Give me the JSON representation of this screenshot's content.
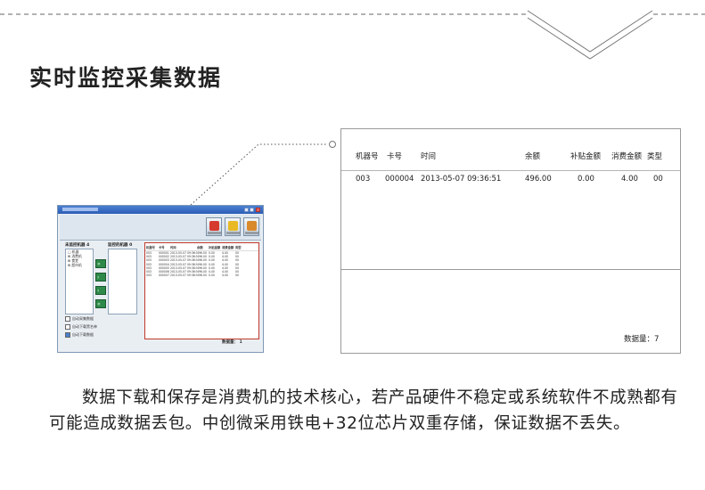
{
  "title": "实时监控采集数据",
  "mini_app": {
    "left_label": "未监控机器",
    "left_count": "4",
    "right_label": "监控的机器",
    "right_count": "0",
    "tree": [
      "□ 机器",
      "⊞ 消费机",
      "⊞ 食堂",
      "⊞ 超市机"
    ],
    "options": [
      "自动采集数据",
      "自动下载黑名单",
      "自动下载数据"
    ],
    "columns": [
      "机器号",
      "卡号",
      "时间",
      "余额",
      "补贴金额",
      "消费金额",
      "类型"
    ],
    "rows": [
      [
        "003",
        "000001",
        "2013-05-07 09:36:51",
        "496.00",
        "0.00",
        "4.00",
        "00"
      ],
      [
        "003",
        "000002",
        "2013-05-07 09:36:51",
        "496.00",
        "0.00",
        "4.00",
        "00"
      ],
      [
        "003",
        "000003",
        "2013-05-07 09:36:51",
        "496.00",
        "0.00",
        "4.00",
        "00"
      ],
      [
        "003",
        "000004",
        "2013-05-07 09:36:51",
        "496.00",
        "0.00",
        "4.00",
        "00"
      ],
      [
        "003",
        "000005",
        "2013-05-07 09:36:51",
        "496.00",
        "0.00",
        "4.00",
        "00"
      ],
      [
        "003",
        "000006",
        "2013-05-07 09:36:51",
        "496.00",
        "0.00",
        "4.00",
        "00"
      ],
      [
        "003",
        "000007",
        "2013-05-07 09:36:51",
        "496.00",
        "0.00",
        "4.00",
        "00"
      ]
    ],
    "count_label": "数据量：",
    "count_value": "1"
  },
  "zoom_table": {
    "columns": [
      "机器号",
      "卡号",
      "时间",
      "余额",
      "补贴金额",
      "消费金额",
      "类型"
    ],
    "row": [
      "003",
      "000004",
      "2013-05-07 09:36:51",
      "496.00",
      "0.00",
      "4.00",
      "00"
    ],
    "count_text": "数据量：7"
  },
  "paragraph": "数据下载和保存是消费机的技术核心，若产品硬件不稳定或系统软件不成熟都有可能造成数据丢包。中创微采用铁电+32位芯片双重存储，保证数据不丢失。",
  "colors": {
    "accent_red": "#c0392b",
    "button_green": "#2f8a4a",
    "titlebar_blue": "#2a5db5"
  },
  "icons": [
    "collect-icon",
    "download-icon",
    "exit-icon"
  ]
}
